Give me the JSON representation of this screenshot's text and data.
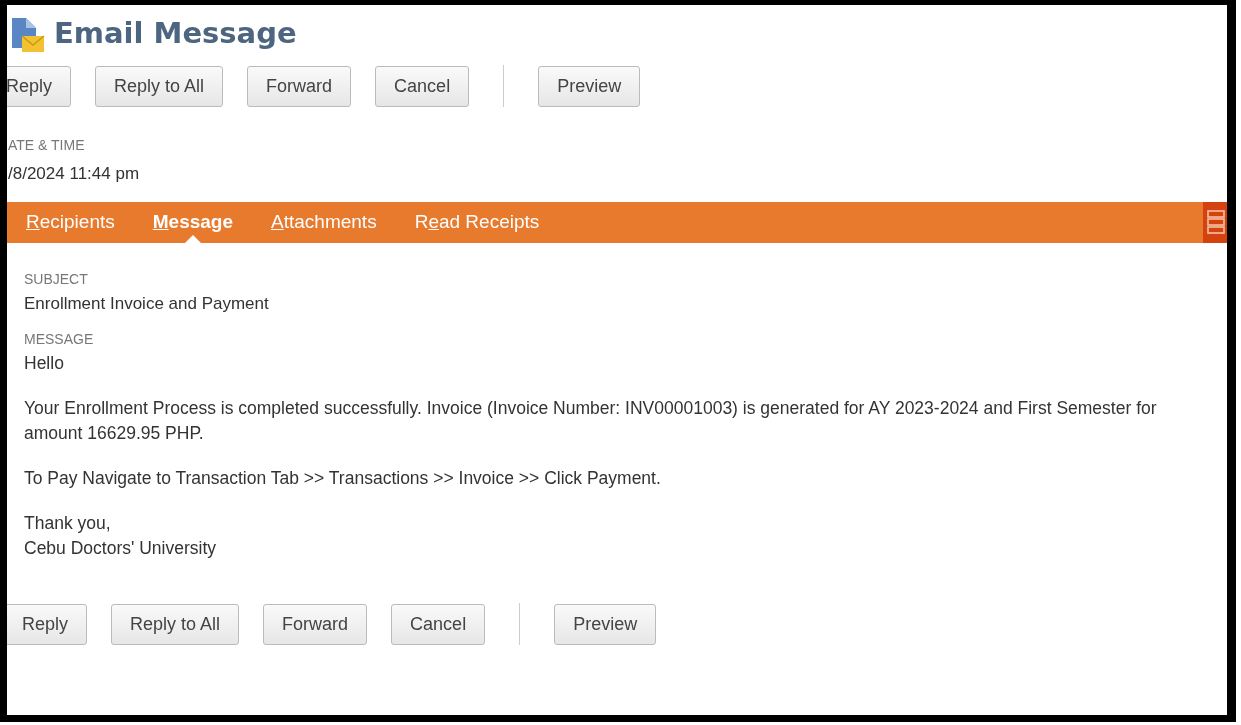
{
  "window": {
    "title": "Email Message"
  },
  "toolbar_top": [
    "Reply",
    "Reply to All",
    "Forward",
    "Cancel",
    "Preview"
  ],
  "date_time": {
    "label": "ATE & TIME",
    "value": "/8/2024 11:44 pm"
  },
  "tabs": [
    {
      "key": "R",
      "post": "ecipients",
      "selected": false
    },
    {
      "key": "M",
      "post": "essage",
      "selected": true
    },
    {
      "key": "A",
      "post": "ttachments",
      "selected": false
    },
    {
      "pre": "R",
      "key": "e",
      "post": "ad Receipts",
      "selected": false
    }
  ],
  "subject": {
    "label": "SUBJECT",
    "value": "Enrollment Invoice and Payment"
  },
  "message": {
    "label": "MESSAGE",
    "paragraphs": [
      "Hello",
      "Your Enrollment Process is completed successfully. Invoice (Invoice Number: INV00001003) is generated for AY 2023-2024 and First Semester for amount 16629.95 PHP.",
      "To Pay Navigate to Transaction Tab >> Transactions >> Invoice >> Click Payment.",
      "Thank you,\nCebu Doctors' University"
    ]
  },
  "toolbar_bottom": [
    "Reply",
    "Reply to All",
    "Forward",
    "Cancel",
    "Preview"
  ]
}
